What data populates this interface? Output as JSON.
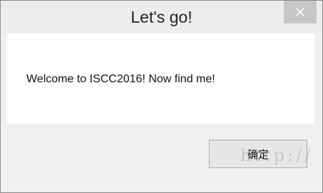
{
  "window": {
    "title": "Let's go!",
    "close_icon": "close-icon"
  },
  "dialog": {
    "message": "Welcome to ISCC2016! Now find me!",
    "ok_label": "确定"
  },
  "watermark": {
    "text": "http://"
  },
  "colors": {
    "titlebar": "#ededed",
    "close_button": "#c7c7c7",
    "content": "#ffffff",
    "footer": "#f0f0f0"
  }
}
